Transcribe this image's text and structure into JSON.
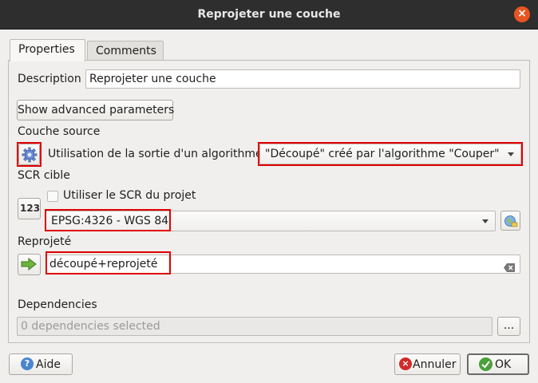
{
  "window": {
    "title": "Reprojeter une couche",
    "close_glyph": "×"
  },
  "tabs": [
    {
      "label": "Properties",
      "active": true
    },
    {
      "label": "Comments",
      "active": false
    }
  ],
  "description": {
    "label": "Description",
    "value": "Reprojeter une couche"
  },
  "advanced_button": {
    "label": "Show advanced parameters"
  },
  "source": {
    "section_label": "Couche source",
    "mode_label": "Utilisation de la sortie d'un algorithme",
    "selected": "\"Découpé\" créé par l'algorithme \"Couper\"",
    "mode_icon": "gear-icon"
  },
  "crs": {
    "section_label": "SCR cible",
    "numeric_icon_text": "123",
    "use_project_label": "Utiliser le SCR du projet",
    "use_project_checked": false,
    "selected": "EPSG:4326 - WGS 84",
    "select_icon": "globe-icon"
  },
  "output": {
    "section_label": "Reprojeté",
    "value": "découpé+reprojeté",
    "mode_icon": "arrow-right-icon",
    "clear_icon": "clear-text-icon"
  },
  "dependencies": {
    "section_label": "Dependencies",
    "placeholder": "0 dependencies selected",
    "browse_label": "..."
  },
  "footer": {
    "help_label": "Aide",
    "cancel_label": "Annuler",
    "ok_label": "OK"
  },
  "highlight_color": "#e00000"
}
